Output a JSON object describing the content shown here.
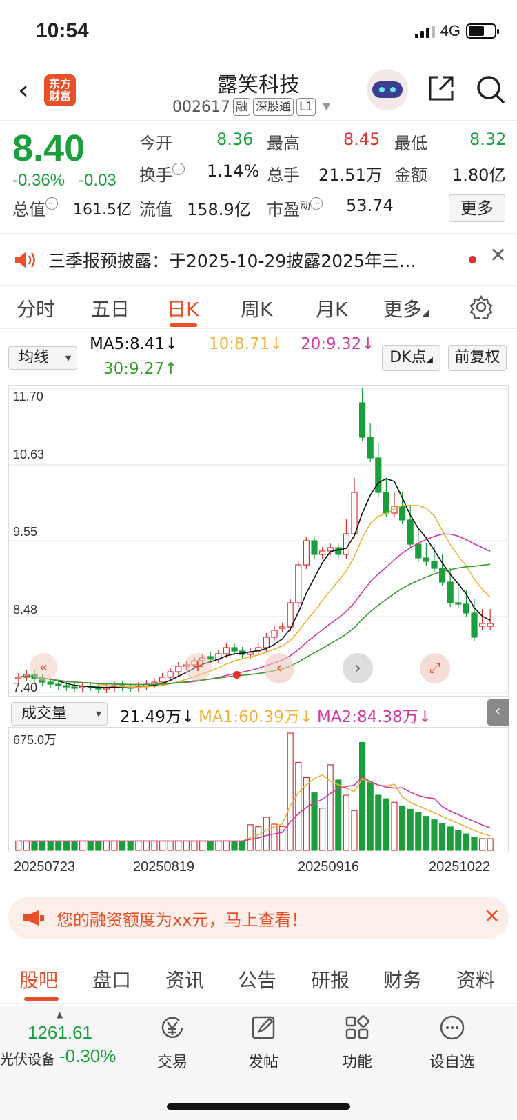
{
  "status": {
    "time": "10:54",
    "network": "4G"
  },
  "header": {
    "logo": "东方财富",
    "title": "露笑科技",
    "code": "002617",
    "tags": [
      "融",
      "深股通",
      "L1"
    ]
  },
  "quote": {
    "price": "8.40",
    "pct": "-0.36%",
    "chg": "-0.03",
    "open_label": "今开",
    "open": "8.36",
    "high_label": "最高",
    "high": "8.45",
    "low_label": "最低",
    "low": "8.32",
    "turnover_label": "换手",
    "turnover": "1.14%",
    "volume_label": "总手",
    "volume": "21.51万",
    "amount_label": "金额",
    "amount": "1.80亿",
    "mktcap_label": "总值",
    "mktcap": "161.5亿",
    "float_label": "流值",
    "float": "158.9亿",
    "pe_label": "市盈",
    "pe_sup": "动",
    "pe": "53.74",
    "more": "更多"
  },
  "notice": {
    "text": "三季报预披露：于2025-10-29披露2025年三…"
  },
  "tabs": [
    "分时",
    "五日",
    "日K",
    "周K",
    "月K",
    "更多"
  ],
  "ma": {
    "select": "均线",
    "ma5": "MA5:8.41",
    "ma10": "10:8.71",
    "ma20": "20:9.32",
    "ma30": "30:9.27",
    "dk": "DK点",
    "fq": "前复权"
  },
  "kaxis": [
    "11.70",
    "10.63",
    "9.55",
    "8.48",
    "7.40"
  ],
  "vol": {
    "select": "成交量",
    "v": "21.49万",
    "ma1": "MA1:60.39万",
    "ma2": "MA2:84.38万",
    "top": "675.0万"
  },
  "dates": [
    "20250723",
    "20250819",
    "20250916",
    "20251022"
  ],
  "banner": {
    "text": "您的融资额度为xx元，马上查看！"
  },
  "btabs": [
    "股吧",
    "盘口",
    "资讯",
    "公告",
    "研报",
    "财务",
    "资料"
  ],
  "bottom": {
    "index": "1261.61",
    "name": "光伏设备",
    "chg": "-0.30%",
    "items": [
      "交易",
      "发帖",
      "功能",
      "设自选"
    ]
  },
  "colors": {
    "up": "#e0312e",
    "down": "#1a9f3c",
    "accent": "#e8502a",
    "ma5": "#111111",
    "ma10": "#f2b33d",
    "ma20": "#d63aa0",
    "ma30": "#3a9d2e"
  }
}
